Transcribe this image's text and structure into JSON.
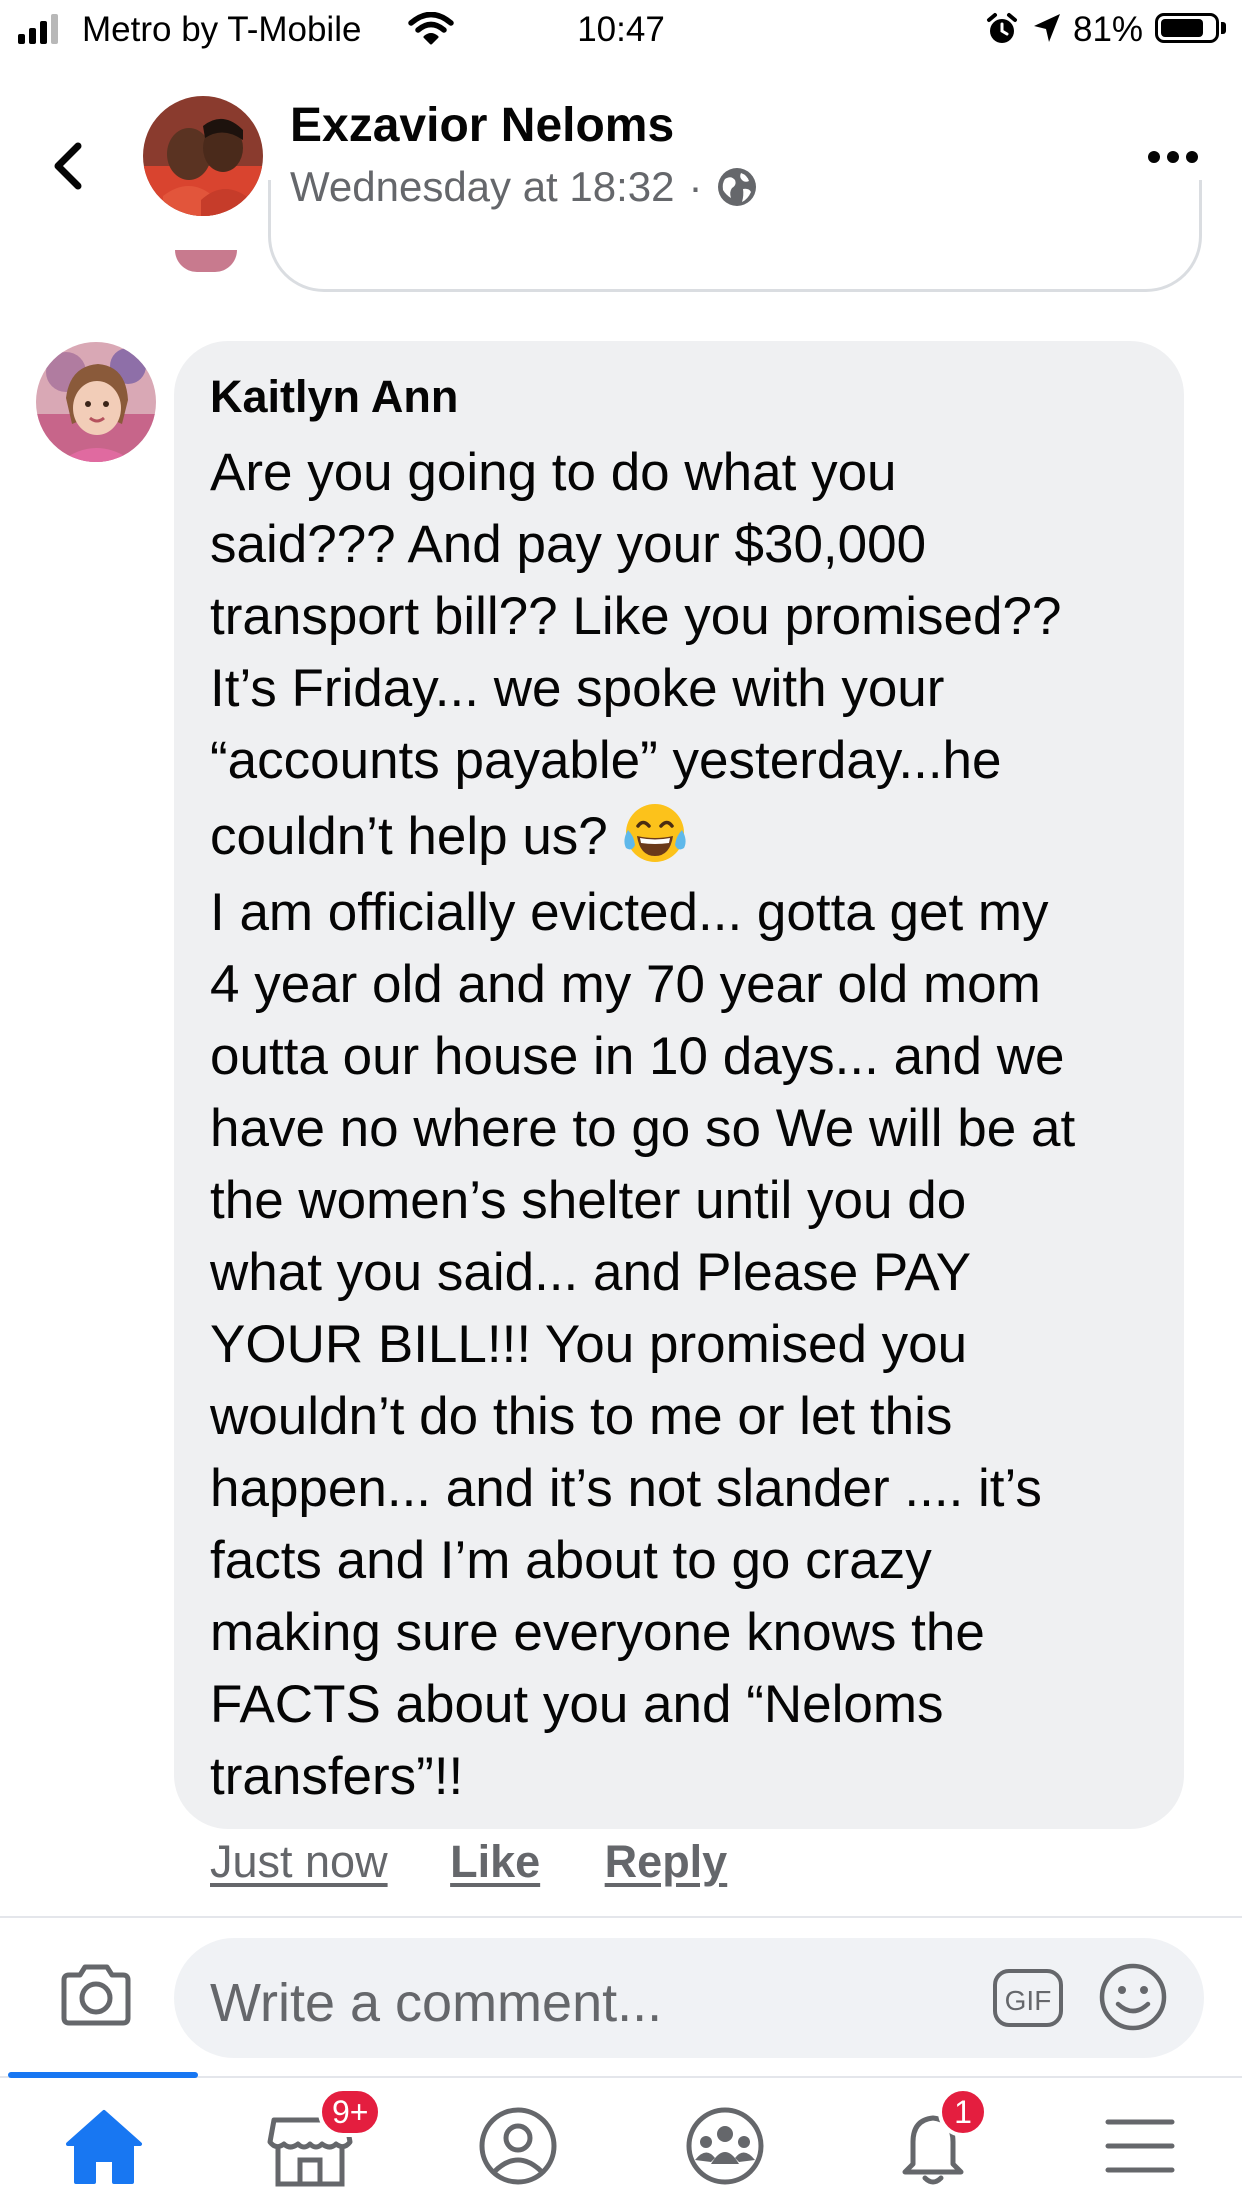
{
  "status_bar": {
    "carrier": "Metro by T-Mobile",
    "time": "10:47",
    "battery_percent": "81%",
    "battery_level": 0.81,
    "signal_bars": 3,
    "icons": [
      "signal-icon",
      "wifi-icon",
      "alarm-icon",
      "location-arrow-icon",
      "battery-icon"
    ]
  },
  "header": {
    "back_icon": "chevron-left-icon",
    "name": "Exzavior Neloms",
    "timestamp": "Wednesday at 18:32",
    "separator": "·",
    "privacy_icon": "globe-icon",
    "more_icon": "more-horizontal-icon"
  },
  "comment": {
    "author": "Kaitlyn Ann",
    "lines": [
      "Are you going to do what you",
      "said??? And pay your $30,000",
      "transport bill?? Like you promised??",
      "It’s Friday... we spoke with your",
      "“accounts payable” yesterday...he",
      "couldn’t help us?",
      "I am officially evicted... gotta get my",
      "4 year old and my 70 year old mom",
      "outta our house in 10 days... and we",
      "have no where to go so We will be at",
      "the women’s shelter until you do",
      "what you said... and Please PAY",
      "YOUR BILL!!! You promised you",
      "wouldn’t do this to me or let this",
      "happen... and it’s not slander .... it’s",
      "facts and I’m about to go crazy",
      "making sure everyone knows the",
      "FACTS about you and “Neloms",
      "transfers”!!"
    ],
    "emoji": "laughing-tears-emoji",
    "time": "Just now",
    "like_label": "Like",
    "reply_label": "Reply"
  },
  "composer": {
    "camera_icon": "camera-icon",
    "placeholder": "Write a comment...",
    "gif_label": "GIF",
    "emoji_icon": "smiley-icon"
  },
  "tab_bar": {
    "tabs": [
      {
        "name": "home",
        "icon": "home-icon",
        "active": true
      },
      {
        "name": "marketplace",
        "icon": "storefront-icon",
        "badge": "9+"
      },
      {
        "name": "profile",
        "icon": "profile-icon"
      },
      {
        "name": "groups",
        "icon": "groups-icon"
      },
      {
        "name": "notifications",
        "icon": "bell-icon",
        "badge": "1"
      },
      {
        "name": "menu",
        "icon": "menu-icon"
      }
    ]
  },
  "colors": {
    "accent": "#1877f2",
    "badge": "#e41e3f",
    "bubble": "#eff0f2",
    "secondary_text": "#65676b"
  }
}
